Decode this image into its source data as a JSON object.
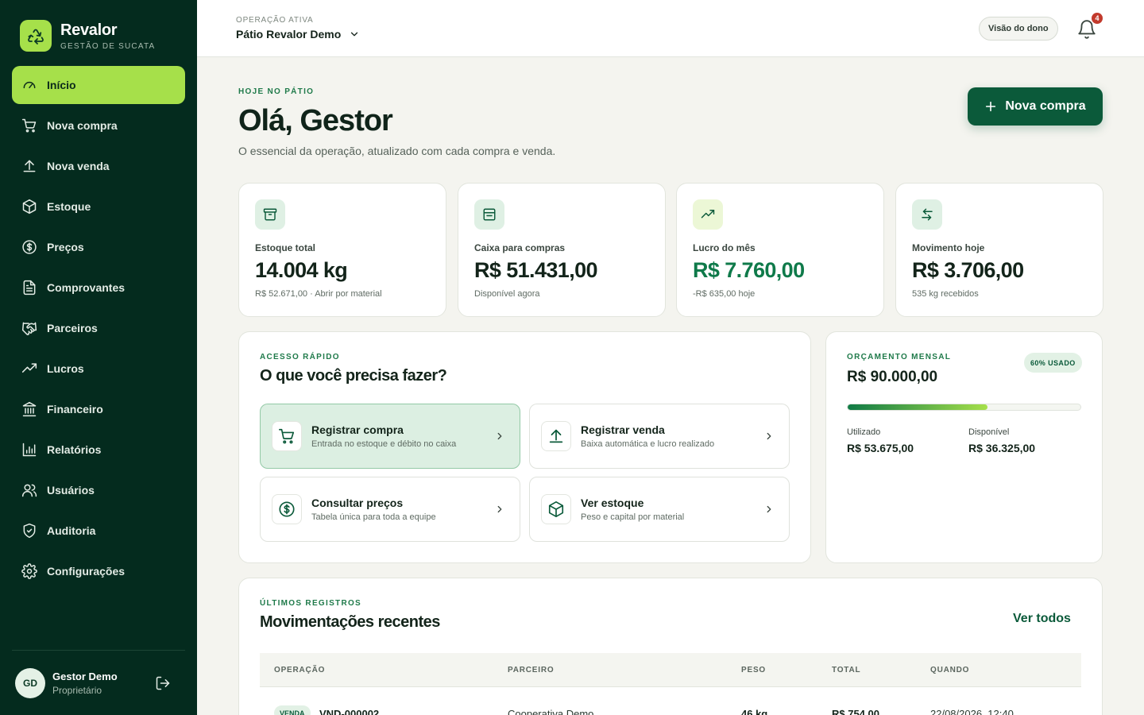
{
  "brand": {
    "name": "Revalor",
    "subtitle": "GESTÃO DE SUCATA"
  },
  "nav": [
    {
      "label": "Início",
      "icon": "gauge-icon",
      "active": true
    },
    {
      "label": "Nova compra",
      "icon": "cart-icon"
    },
    {
      "label": "Nova venda",
      "icon": "upload-icon"
    },
    {
      "label": "Estoque",
      "icon": "box-icon"
    },
    {
      "label": "Preços",
      "icon": "dollar-icon"
    },
    {
      "label": "Comprovantes",
      "icon": "receipt-icon"
    },
    {
      "label": "Parceiros",
      "icon": "handshake-icon"
    },
    {
      "label": "Lucros",
      "icon": "trend-icon"
    },
    {
      "label": "Financeiro",
      "icon": "bank-icon"
    },
    {
      "label": "Relatórios",
      "icon": "bar-chart-icon"
    },
    {
      "label": "Usuários",
      "icon": "users-icon"
    },
    {
      "label": "Auditoria",
      "icon": "shield-icon"
    },
    {
      "label": "Configurações",
      "icon": "gear-icon"
    }
  ],
  "user": {
    "initials": "GD",
    "name": "Gestor Demo",
    "role": "Proprietário"
  },
  "topbar": {
    "op_label": "OPERAÇÃO ATIVA",
    "op_value": "Pátio Revalor Demo",
    "owner_view": "Visão do dono",
    "notifications": "4"
  },
  "hero": {
    "eyebrow": "HOJE NO PÁTIO",
    "title": "Olá, Gestor",
    "subtitle": "O essencial da operação, atualizado com cada compra e venda.",
    "cta": "Nova compra"
  },
  "stats": [
    {
      "label": "Estoque total",
      "value": "14.004 kg",
      "sub": "R$ 52.671,00 · Abrir por material",
      "icon": "archive-icon"
    },
    {
      "label": "Caixa para compras",
      "value": "R$ 51.431,00",
      "sub": "Disponível agora",
      "icon": "wallet-icon"
    },
    {
      "label": "Lucro do mês",
      "value": "R$ 7.760,00",
      "sub": "-R$ 635,00 hoje",
      "icon": "trend-up-icon"
    },
    {
      "label": "Movimento hoje",
      "value": "R$ 3.706,00",
      "sub": "535 kg recebidos",
      "icon": "swap-icon"
    }
  ],
  "quick": {
    "eyebrow": "ACESSO RÁPIDO",
    "title": "O que você precisa fazer?",
    "actions": [
      {
        "title": "Registrar compra",
        "desc": "Entrada no estoque e débito no caixa"
      },
      {
        "title": "Registrar venda",
        "desc": "Baixa automática e lucro realizado"
      },
      {
        "title": "Consultar preços",
        "desc": "Tabela única para toda a equipe"
      },
      {
        "title": "Ver estoque",
        "desc": "Peso e capital por material"
      }
    ]
  },
  "budget": {
    "eyebrow": "ORÇAMENTO MENSAL",
    "value": "R$ 90.000,00",
    "badge": "60% USADO",
    "used_fraction": 0.6,
    "used_label": "Utilizado",
    "used_value": "R$ 53.675,00",
    "avail_label": "Disponível",
    "avail_value": "R$ 36.325,00"
  },
  "recent": {
    "eyebrow": "ÚLTIMOS REGISTROS",
    "title": "Movimentações recentes",
    "see_all": "Ver todos",
    "columns": [
      "OPERAÇÃO",
      "PARCEIRO",
      "PESO",
      "TOTAL",
      "QUANDO"
    ],
    "rows": [
      {
        "type": "VENDA",
        "code": "VND-000002",
        "partner": "Cooperativa Demo",
        "weight": "46 kg",
        "total": "R$ 754,00",
        "when": "22/08/2026, 12:40"
      }
    ]
  }
}
